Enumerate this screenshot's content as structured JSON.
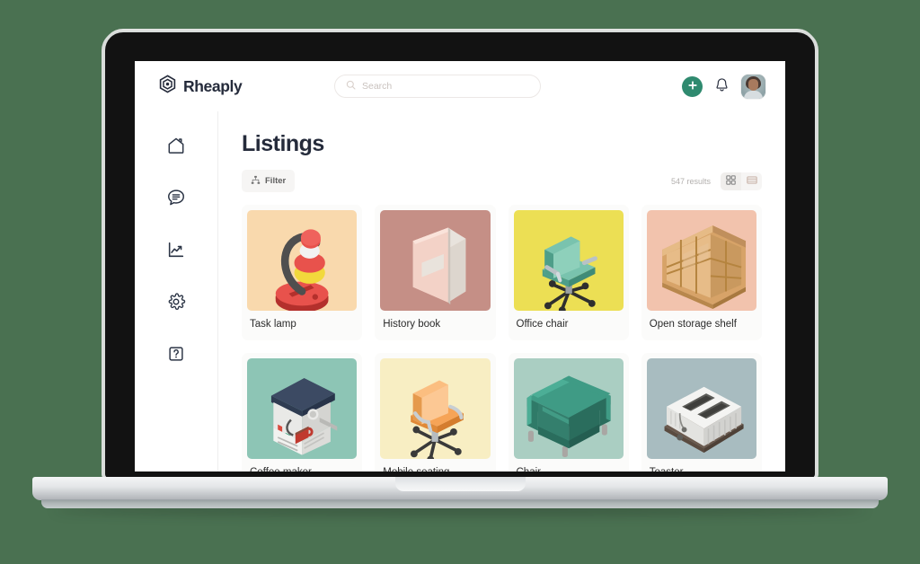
{
  "header": {
    "brand_name": "Rheaply",
    "brand_logo_icon": "rheaply-hexagon-logo",
    "search": {
      "placeholder": "Search",
      "value": "",
      "icon": "search-icon"
    },
    "add_button_icon": "plus-icon",
    "notifications_icon": "bell-icon",
    "avatar_alt": "User avatar"
  },
  "sidebar": {
    "items": [
      {
        "name": "home",
        "icon": "home-icon"
      },
      {
        "name": "messages",
        "icon": "chat-bubble-icon"
      },
      {
        "name": "analytics",
        "icon": "trending-chart-icon"
      },
      {
        "name": "settings",
        "icon": "gear-icon"
      },
      {
        "name": "help",
        "icon": "question-mark-icon"
      }
    ]
  },
  "main": {
    "page_title": "Listings",
    "filter_label": "Filter",
    "filter_icon": "hierarchy-filter-icon",
    "results_count": "547 results",
    "view_modes": [
      {
        "name": "grid",
        "icon": "grid-view-icon",
        "active": true
      },
      {
        "name": "list",
        "icon": "list-view-icon",
        "active": false
      }
    ],
    "listings": [
      {
        "title": "Task lamp",
        "bg": "#f9d9ad",
        "art": "task-lamp"
      },
      {
        "title": "History book",
        "bg": "#c58f86",
        "art": "history-book"
      },
      {
        "title": "Office chair",
        "bg": "#ecdf54",
        "art": "office-chair"
      },
      {
        "title": "Open storage shelf",
        "bg": "#f2c3ad",
        "art": "open-storage-shelf"
      },
      {
        "title": "Coffee maker",
        "bg": "#8dc5b5",
        "art": "coffee-maker"
      },
      {
        "title": "Mobile seating",
        "bg": "#f8eec3",
        "art": "mobile-seating"
      },
      {
        "title": "Chair",
        "bg": "#aacec2",
        "art": "lounge-chair"
      },
      {
        "title": "Toaster",
        "bg": "#a8bcc0",
        "art": "toaster"
      }
    ]
  },
  "colors": {
    "page_background": "#4a7151",
    "accent_green": "#2f8a6f",
    "text_dark": "#252b3b",
    "card_background": "#fbfbfa"
  }
}
